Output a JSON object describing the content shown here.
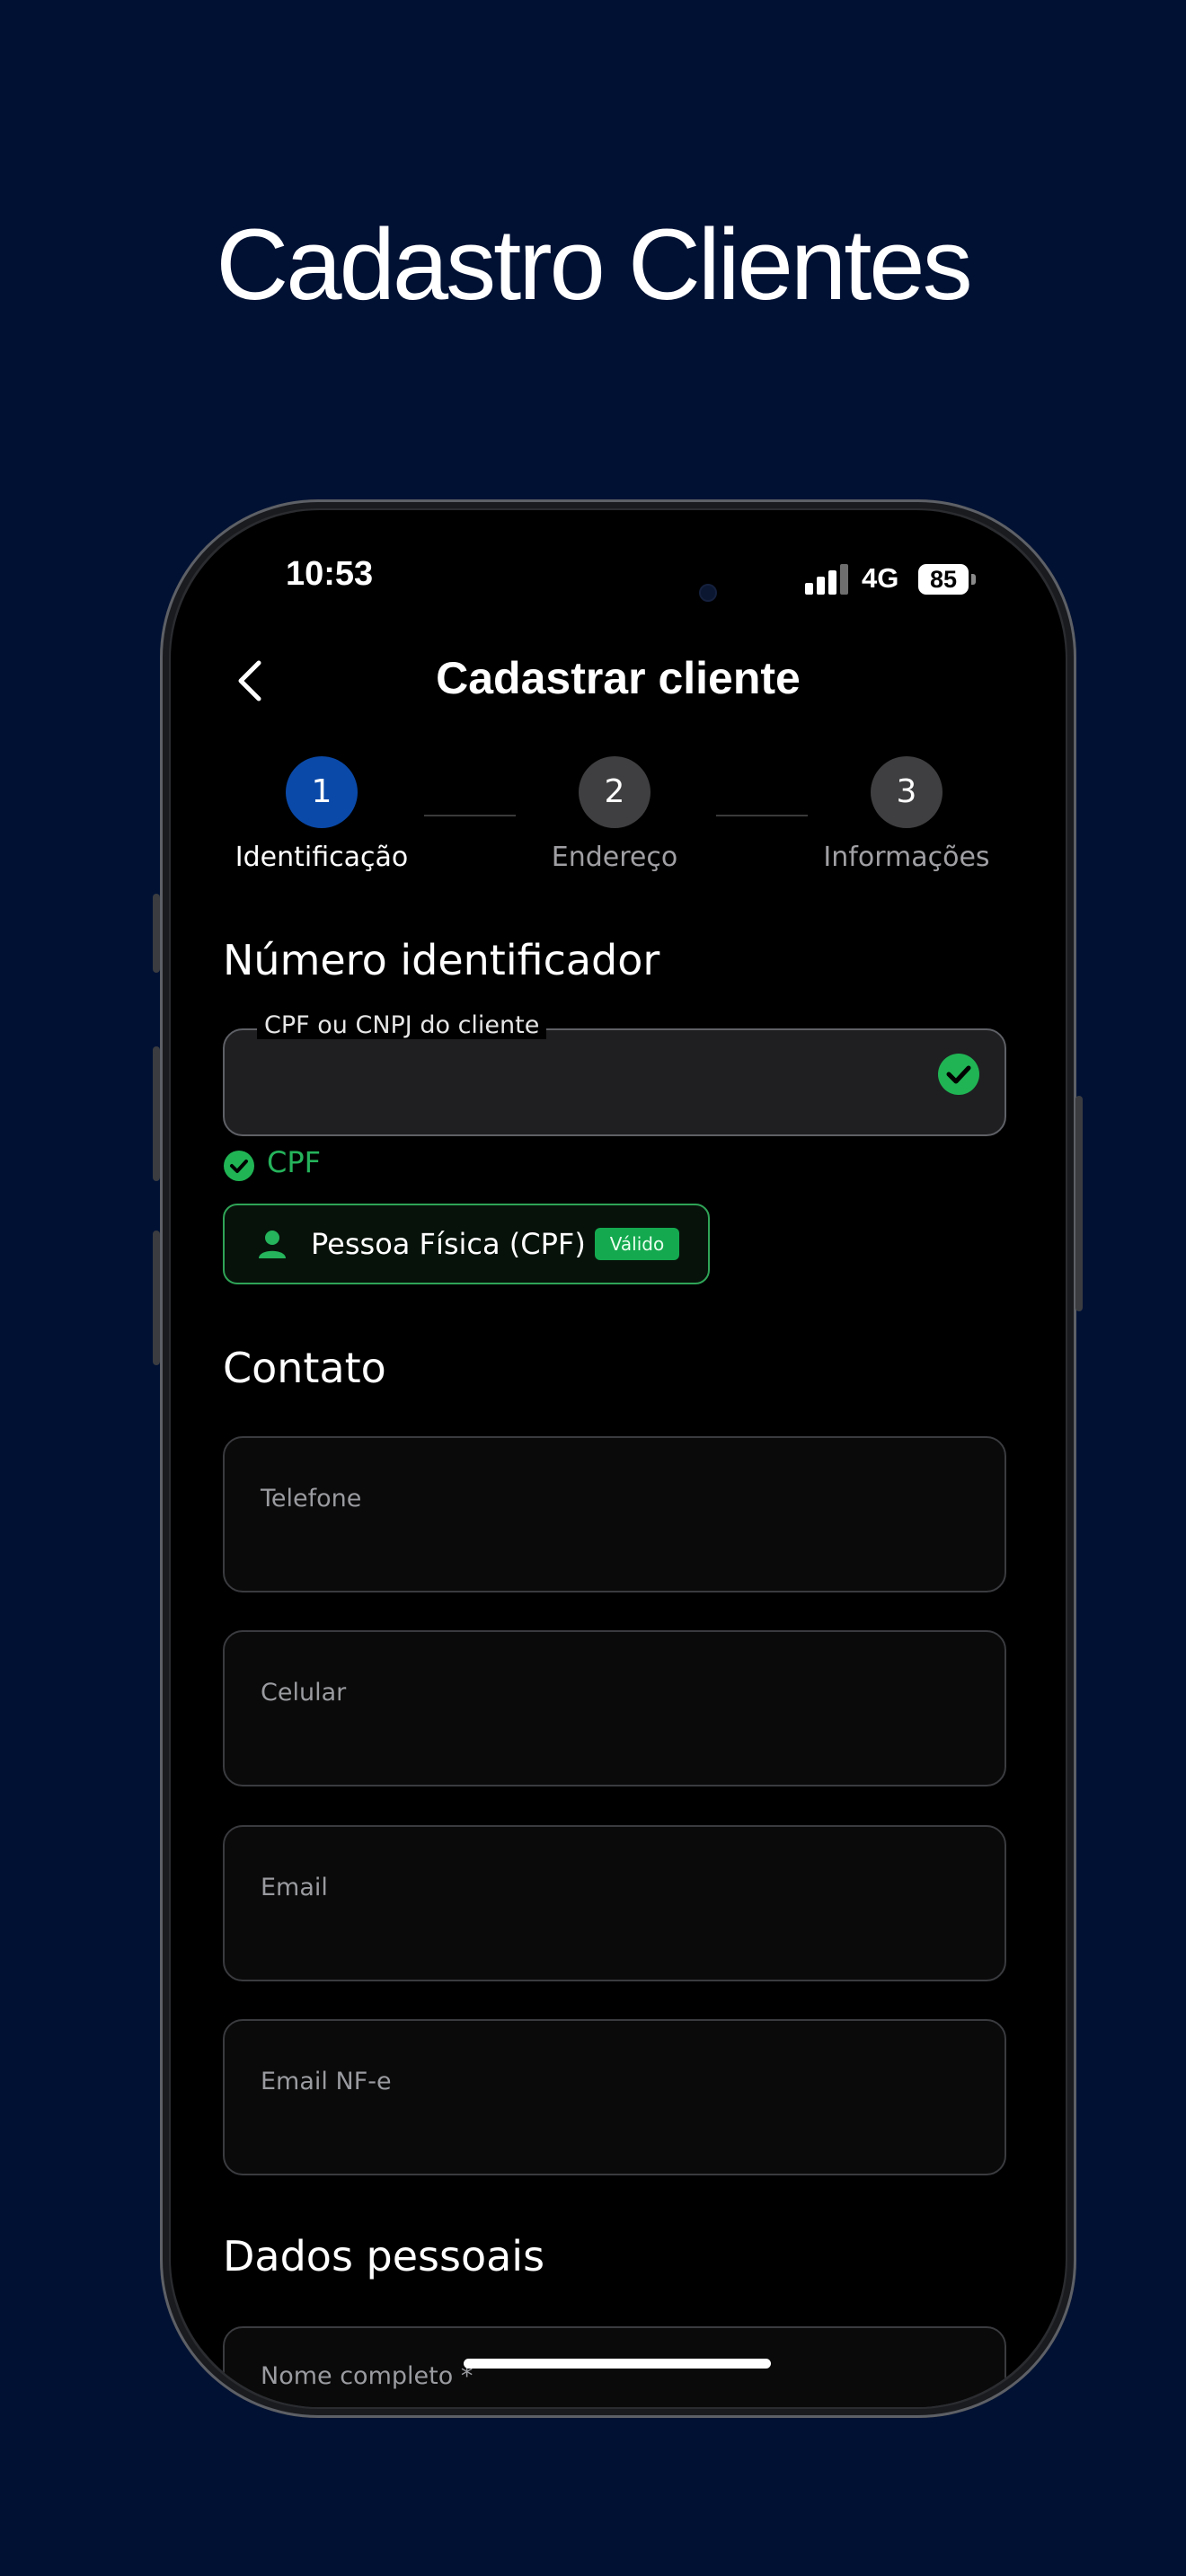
{
  "headline": "Cadastro Clientes",
  "status_bar": {
    "time": "10:53",
    "network": "4G",
    "battery": "85"
  },
  "nav": {
    "title": "Cadastrar cliente",
    "back_icon": "chevron-left-icon"
  },
  "steps": [
    {
      "number": "1",
      "label": "Identificação",
      "active": true
    },
    {
      "number": "2",
      "label": "Endereço",
      "active": false
    },
    {
      "number": "3",
      "label": "Informações",
      "active": false
    }
  ],
  "identifier": {
    "section_title": "Número identificador",
    "field_label": "CPF ou CNPJ do cliente",
    "field_value": "",
    "validation_text": "CPF",
    "person_type": "Pessoa Física (CPF)",
    "valid_tag": "Válido"
  },
  "contact": {
    "section_title": "Contato",
    "fields": [
      "Telefone",
      "Celular",
      "Email",
      "Email NF-e"
    ]
  },
  "personal": {
    "section_title": "Dados pessoais",
    "fields": [
      "Nome completo *"
    ]
  },
  "colors": {
    "background": "#001134",
    "accent_blue": "#0a49a8",
    "success_green": "#25b35b",
    "inactive_step": "#3f3f41"
  }
}
